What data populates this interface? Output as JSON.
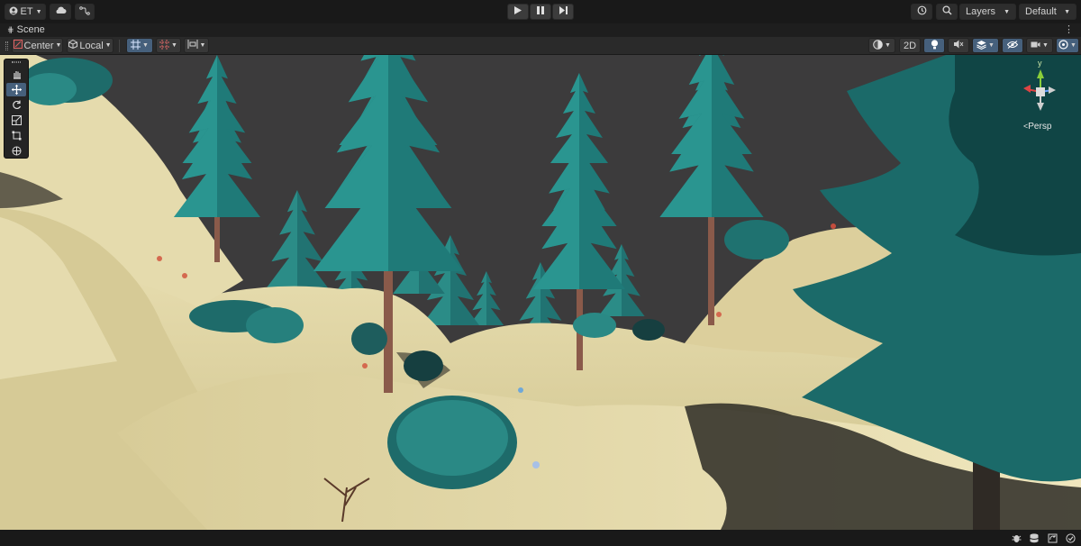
{
  "toolbar_top": {
    "account_label": "ET",
    "play_tooltip": "",
    "layers_label": "Layers",
    "layout_label": "Default"
  },
  "scene_tab": {
    "label": "Scene"
  },
  "scene_toolbar": {
    "pivot_label": "Center",
    "space_label": "Local",
    "mode_2d_label": "2D"
  },
  "gizmo": {
    "axis_y": "y",
    "projection_label": "Persp"
  },
  "colors": {
    "accent": "#46607c",
    "tree_teal": "#1f7a78",
    "ground": "#e3d8a8",
    "sky": "#3c3b3c"
  }
}
